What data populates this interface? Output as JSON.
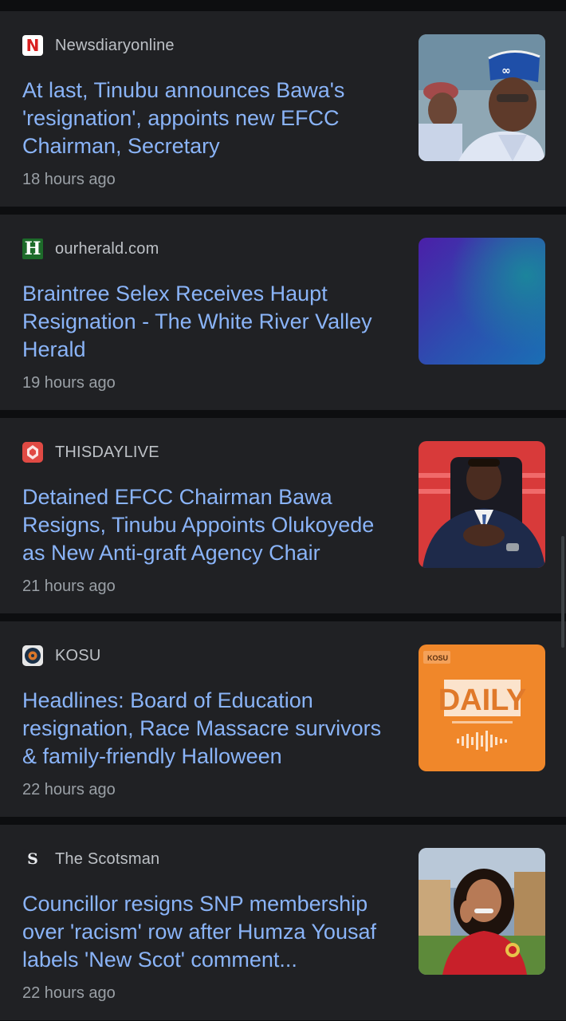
{
  "articles": [
    {
      "source": "Newsdiaryonline",
      "source_logo": "N",
      "headline": "At last, Tinubu announces Bawa's 'resignation', appoints new EFCC Chairman, Secretary",
      "time": "18 hours ago"
    },
    {
      "source": "ourherald.com",
      "source_logo": "H",
      "headline": "Braintree Selex Receives Haupt Resignation - The White River Valley Herald",
      "time": "19 hours ago"
    },
    {
      "source": "THISDAYLIVE",
      "source_logo": "",
      "headline": "Detained EFCC Chairman Bawa Resigns, Tinubu Appoints Olukoyede as New Anti-graft Agency Chair",
      "time": "21 hours ago"
    },
    {
      "source": "KOSU",
      "source_logo": "",
      "headline": "Headlines: Board of Education resignation, Race Massacre survivors & family-friendly Halloween",
      "time": "22 hours ago",
      "thumbnail_text": "DAILY",
      "thumbnail_brand": "KOSU"
    },
    {
      "source": "The Scotsman",
      "source_logo": "S",
      "headline": "Councillor resigns SNP membership over 'racism' row after Humza Yousaf labels 'New Scot' comment...",
      "time": "22 hours ago"
    }
  ],
  "colors": {
    "card_background": "#202124",
    "page_background": "#0d0e10",
    "headline": "#8ab4f8",
    "source_text": "#bdc1c6",
    "time_text": "#9aa0a6"
  }
}
